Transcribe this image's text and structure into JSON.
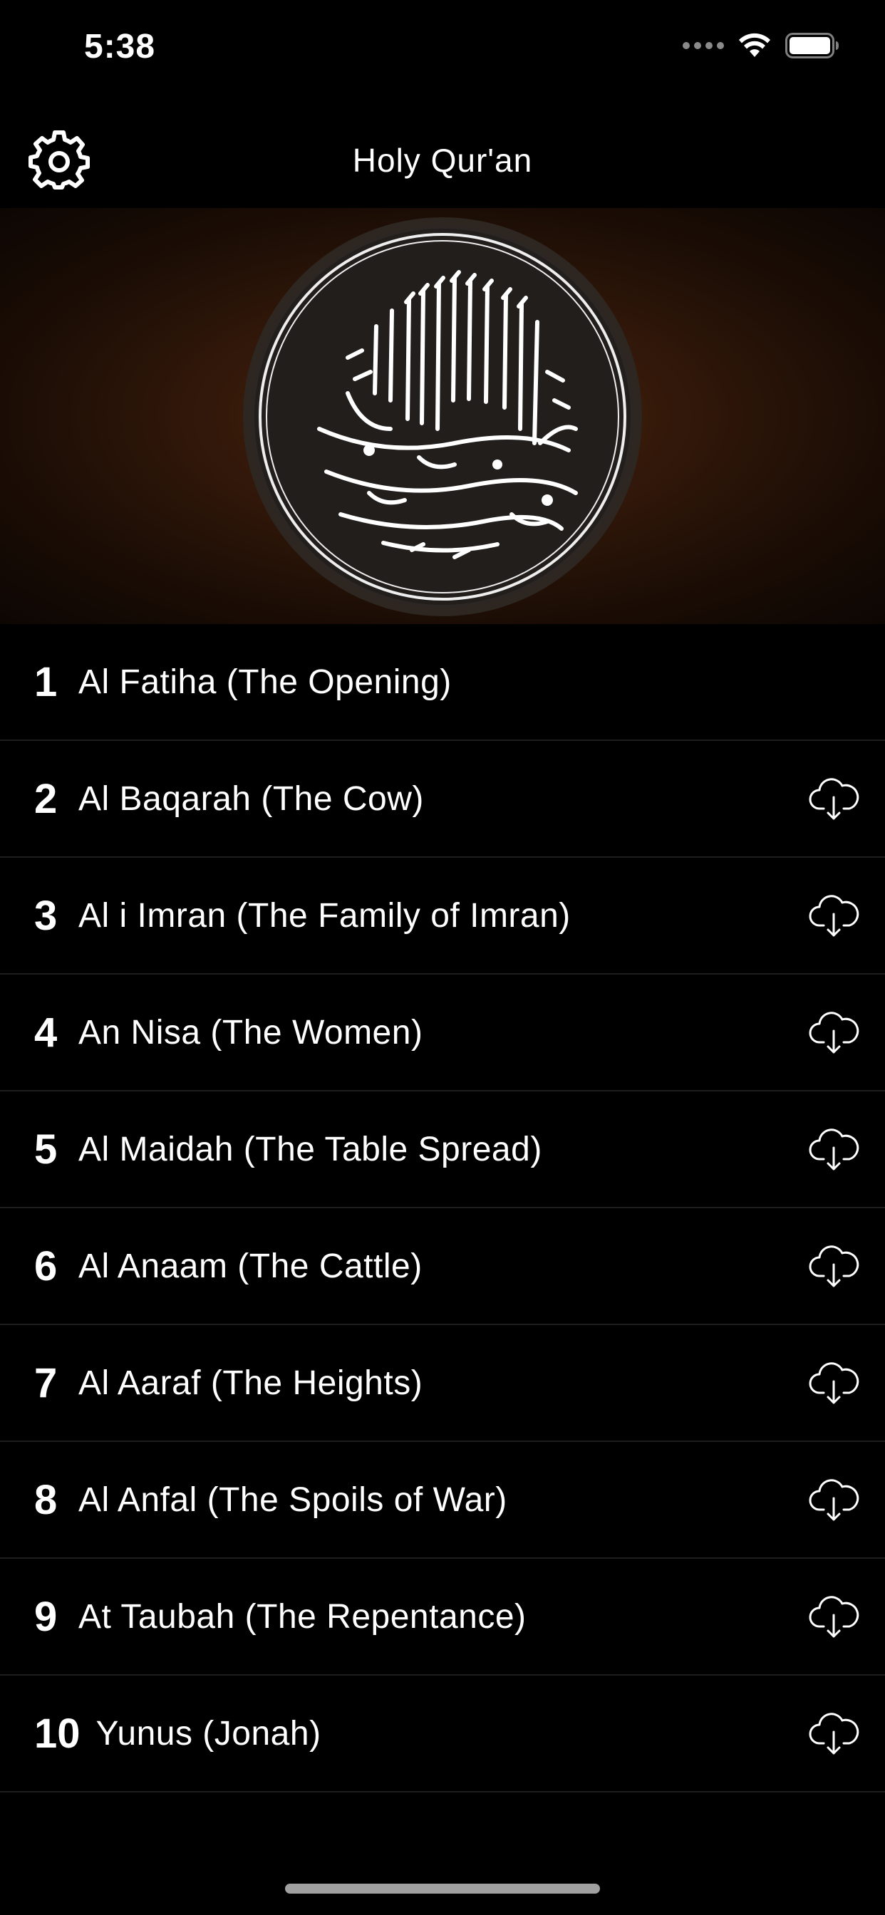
{
  "status_bar": {
    "time": "5:38",
    "icons": [
      "cellular-dots-icon",
      "wifi-icon",
      "battery-icon"
    ]
  },
  "nav": {
    "title": "Holy Qur'an",
    "settings_icon": "gear-icon"
  },
  "banner": {
    "image": "bismillah-calligraphy-medallion",
    "background_color": "#3a1c0a"
  },
  "surahs": [
    {
      "number": "1",
      "name": "Al Fatiha (The Opening)",
      "downloadable": false
    },
    {
      "number": "2",
      "name": "Al Baqarah (The Cow)",
      "downloadable": true
    },
    {
      "number": "3",
      "name": "Al i Imran (The Family of Imran)",
      "downloadable": true
    },
    {
      "number": "4",
      "name": "An Nisa (The Women)",
      "downloadable": true
    },
    {
      "number": "5",
      "name": "Al Maidah (The Table Spread)",
      "downloadable": true
    },
    {
      "number": "6",
      "name": "Al Anaam (The Cattle)",
      "downloadable": true
    },
    {
      "number": "7",
      "name": "Al Aaraf (The Heights)",
      "downloadable": true
    },
    {
      "number": "8",
      "name": "Al Anfal (The Spoils of War)",
      "downloadable": true
    },
    {
      "number": "9",
      "name": "At Taubah (The Repentance)",
      "downloadable": true
    },
    {
      "number": "10",
      "name": "Yunus (Jonah)",
      "downloadable": true
    }
  ],
  "colors": {
    "background": "#000000",
    "text": "#ffffff",
    "separator": "#1e1e1e"
  }
}
